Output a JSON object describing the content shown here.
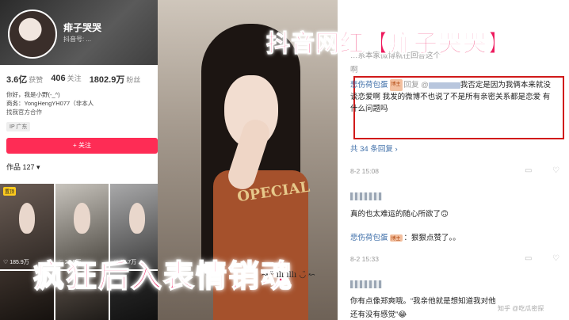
{
  "overlay": {
    "title_top": "抖音网红【痱子哭哭】",
    "title_bottom": "疯狂后入表情销魂",
    "deco": "↝ ᵕ̈ ılı ıllı ◡̈ ↜"
  },
  "profile": {
    "name": "痱子哭哭",
    "id_text": "抖音号: ...",
    "stats": [
      {
        "value": "3.6亿",
        "label": "获赞"
      },
      {
        "value": "406",
        "label": "关注"
      },
      {
        "value": "1802.9万",
        "label": "粉丝"
      }
    ],
    "bio_lines": [
      "你好，我是小野(-_^)",
      "商务：YongHengYH077（非本人",
      "找我官方合作"
    ],
    "location_tag": "IP 广东",
    "follow_label": "+ 关注",
    "works_label": "作品 127 ▾",
    "grid": [
      {
        "pin": "置顶",
        "likes": "♡ 185.9万"
      },
      {
        "pin": "",
        "likes": "♡ 22.9万"
      },
      {
        "pin": "",
        "likes": "♡ 19.7万"
      },
      {
        "pin": "",
        "likes": ""
      },
      {
        "pin": "",
        "likes": ""
      },
      {
        "pin": "",
        "likes": ""
      }
    ]
  },
  "photo": {
    "shirt_text": "OPECIAL"
  },
  "comments": {
    "top_faded": "…系本家微博就在回答这个",
    "top_faded2": "啊",
    "reply": {
      "author": "悲伤荷包蛋",
      "badge": "博主",
      "prefix": "回复 @",
      "text": "我否定是因为我俩本来就没谈恋爱啊 我发的微博不也说了不是所有亲密关系都是恋爱 有什么问题吗"
    },
    "more_replies": "共 34 条回复 ›",
    "time1": "8-2 15:08",
    "comment2": "真的也太难运的随心所欲了🙃",
    "reply2_author": "悲伤荷包蛋",
    "reply2_badge": "博主",
    "reply2_text": "：狠狠点赞了。。",
    "time2": "8-2 15:33",
    "comment3_line1": "你有点像郑爽哦。“我亲他就是想知道我对他",
    "comment3_line2": "还有没有感觉”😂",
    "watermark": "知乎 @吃瓜密探"
  }
}
